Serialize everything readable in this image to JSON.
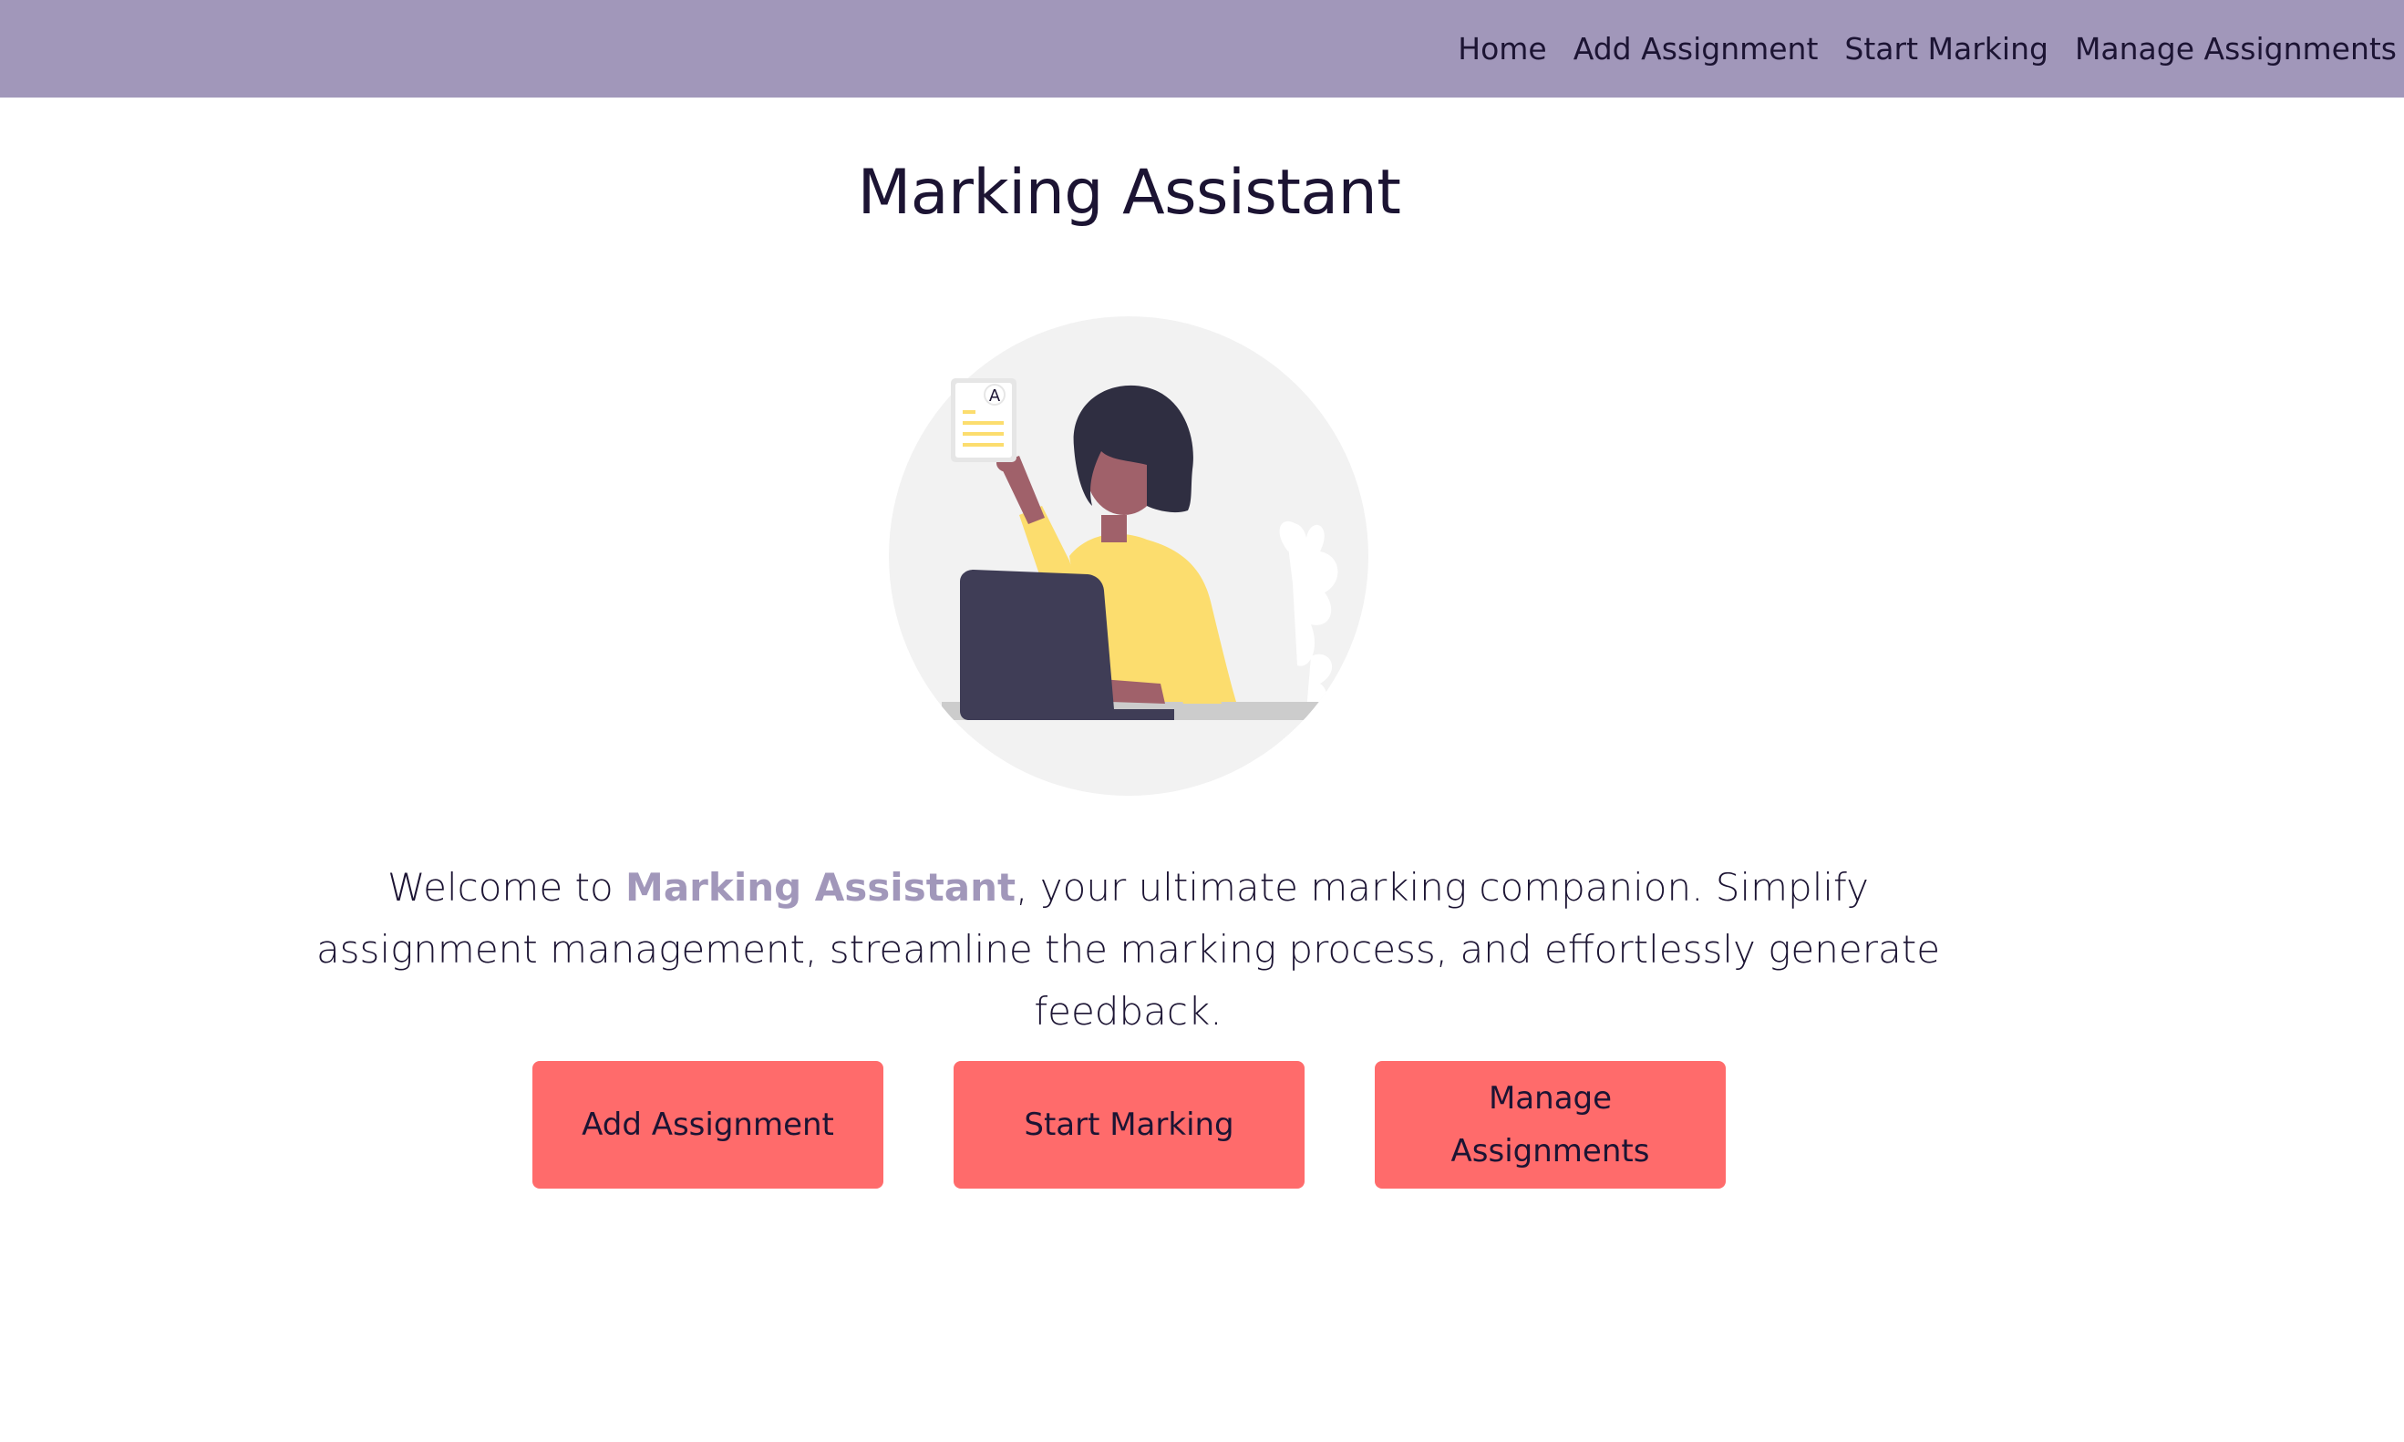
{
  "colors": {
    "navbar": "#a197ba",
    "accent": "#a197ba",
    "button": "#ff6b6b",
    "text": "#1c1433",
    "illustration_shirt": "#fcdd6e",
    "illustration_laptop": "#3f3d56"
  },
  "nav": {
    "links": [
      {
        "label": "Home"
      },
      {
        "label": "Add Assignment"
      },
      {
        "label": "Start Marking"
      },
      {
        "label": "Manage Assignments"
      }
    ]
  },
  "main": {
    "title": "Marking Assistant",
    "illustration": {
      "icon": "person-marking-assignment-illustration",
      "document_grade": "A"
    },
    "intro": {
      "prefix": "Welcome to ",
      "brand": "Marking Assistant",
      "suffix": ", your ultimate marking companion. Simplify assignment management, streamline the marking process, and effortlessly generate feedback."
    },
    "buttons": [
      {
        "label": "Add Assignment"
      },
      {
        "label": "Start Marking"
      },
      {
        "label": "Manage Assignments"
      }
    ]
  }
}
